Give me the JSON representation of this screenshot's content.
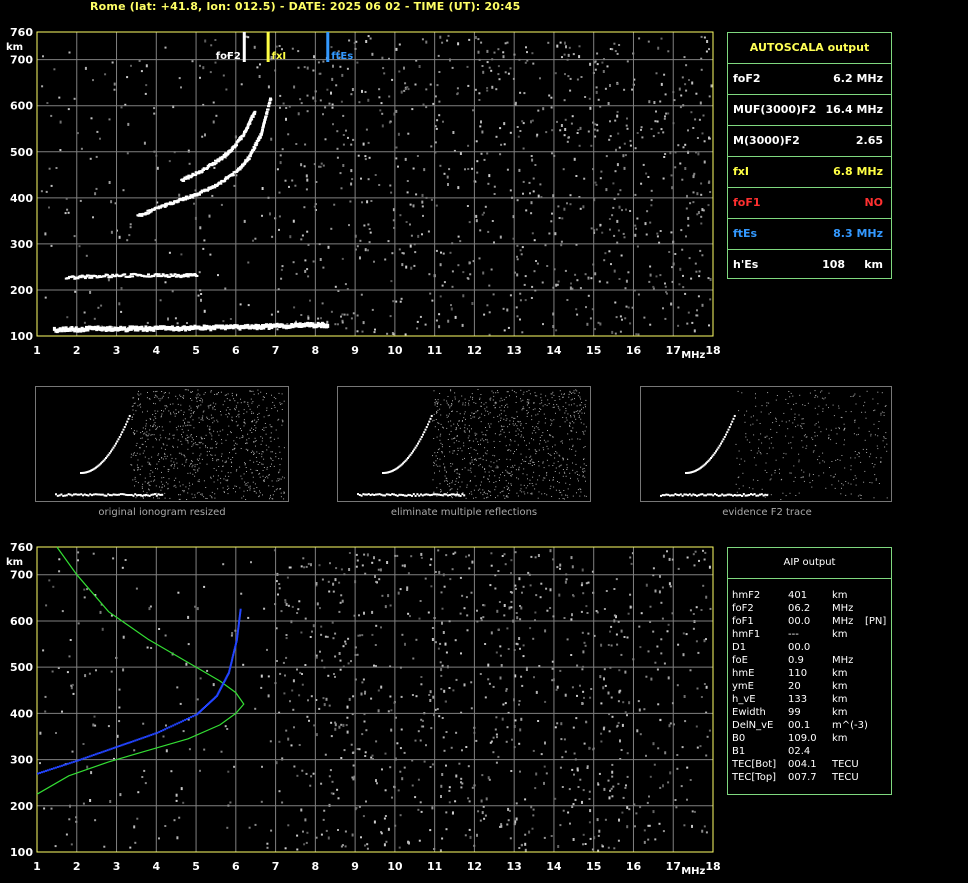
{
  "header": "Rome (lat: +41.8, lon: 012.5) - DATE: 2025 06 02 - TIME (UT): 20:45",
  "colors": {
    "axis": "#ffff66",
    "grid": "#808080",
    "panel_border": "#7fd87f",
    "fof2": "#ffffff",
    "fxi": "#ffff44",
    "ftes": "#3399ff",
    "fof1": "#ff3030",
    "profile": "#33dd33",
    "trace_fit": "#2244ff"
  },
  "chart_data": [
    {
      "id": "ionogram-top",
      "type": "scatter",
      "xlim": [
        1,
        18
      ],
      "ylim": [
        100,
        760
      ],
      "x_ticks": [
        1,
        2,
        3,
        4,
        5,
        6,
        7,
        8,
        9,
        10,
        11,
        12,
        13,
        14,
        15,
        16,
        17,
        18
      ],
      "y_ticks": [
        100,
        200,
        300,
        400,
        500,
        600,
        700,
        760
      ],
      "x_unit": "MHz",
      "y_unit": "km",
      "grid": true,
      "markers": [
        {
          "label": "foF2",
          "x": 6.2,
          "color": "#ffffff"
        },
        {
          "label": "fxI",
          "x": 6.8,
          "color": "#ffff44"
        },
        {
          "label": "ftEs",
          "x": 8.3,
          "color": "#3399ff"
        }
      ],
      "traces": [
        {
          "name_hidden": "Es",
          "x": [
            1.4,
            2.5,
            3.5,
            4.5,
            5.5,
            6.5,
            7.5,
            8.3
          ],
          "y": [
            118,
            120,
            120,
            121,
            122,
            124,
            127,
            128
          ]
        },
        {
          "name_hidden": "Es-2",
          "x": [
            1.7,
            2.5,
            3.5,
            4.5,
            5.0
          ],
          "y": [
            228,
            232,
            234,
            233,
            234
          ]
        },
        {
          "name_hidden": "F2-o",
          "x": [
            3.5,
            4.0,
            4.5,
            5.0,
            5.5,
            6.0,
            6.3,
            6.6,
            6.85
          ],
          "y": [
            362,
            380,
            395,
            410,
            430,
            460,
            490,
            540,
            620
          ]
        },
        {
          "name_hidden": "F2-x",
          "x": [
            4.6,
            5.1,
            5.6,
            5.9,
            6.2,
            6.45
          ],
          "y": [
            440,
            460,
            488,
            510,
            545,
            590
          ]
        }
      ]
    },
    {
      "id": "ionogram-bottom",
      "type": "scatter",
      "xlim": [
        1,
        18
      ],
      "ylim": [
        100,
        760
      ],
      "x_ticks": [
        1,
        2,
        3,
        4,
        5,
        6,
        7,
        8,
        9,
        10,
        11,
        12,
        13,
        14,
        15,
        16,
        17,
        18
      ],
      "y_ticks": [
        100,
        200,
        300,
        400,
        500,
        600,
        700,
        760
      ],
      "x_unit": "MHz",
      "y_unit": "km",
      "grid": true,
      "profile": {
        "x": [
          1.0,
          1.8,
          2.8,
          3.8,
          4.8,
          5.6,
          6.0,
          6.2,
          6.0,
          5.6,
          4.8,
          3.8,
          2.8,
          2.0,
          1.5
        ],
        "y": [
          225,
          265,
          295,
          320,
          345,
          375,
          400,
          420,
          445,
          470,
          510,
          560,
          620,
          700,
          760
        ]
      },
      "fit": {
        "x": [
          1.0,
          2.0,
          3.0,
          4.0,
          5.0,
          5.5,
          5.8,
          6.0,
          6.1
        ],
        "y": [
          272,
          300,
          330,
          360,
          400,
          440,
          490,
          560,
          630
        ]
      }
    }
  ],
  "thumbs": [
    {
      "caption": "original ionogram resized"
    },
    {
      "caption": "eliminate multiple reflections"
    },
    {
      "caption": "evidence F2 trace"
    }
  ],
  "autoscala": {
    "title": "AUTOSCALA output",
    "rows": [
      {
        "label": "foF2",
        "value": "6.2 MHz",
        "color": "#ffffff"
      },
      {
        "label": "MUF(3000)F2",
        "value": "16.4 MHz",
        "color": "#ffffff"
      },
      {
        "label": "M(3000)F2",
        "value": "2.65",
        "color": "#ffffff"
      },
      {
        "label": "fxI",
        "value": "6.8 MHz",
        "color": "#ffff44"
      },
      {
        "label": "foF1",
        "value": "NO",
        "color": "#ff3030"
      },
      {
        "label": "ftEs",
        "value": "8.3 MHz",
        "color": "#3399ff"
      },
      {
        "label": "h'Es",
        "value": "108     km",
        "color": "#ffffff"
      }
    ]
  },
  "aip": {
    "title": "AIP output",
    "rows": [
      {
        "name": "hmF2",
        "value": "401",
        "unit": "km",
        "extra": ""
      },
      {
        "name": "foF2",
        "value": "06.2",
        "unit": "MHz",
        "extra": ""
      },
      {
        "name": "foF1",
        "value": "00.0",
        "unit": "MHz",
        "extra": "[PN]"
      },
      {
        "name": "hmF1",
        "value": "---",
        "unit": "km",
        "extra": ""
      },
      {
        "name": "D1",
        "value": "00.0",
        "unit": "",
        "extra": ""
      },
      {
        "name": "foE",
        "value": "0.9",
        "unit": "MHz",
        "extra": ""
      },
      {
        "name": "hmE",
        "value": "110",
        "unit": "km",
        "extra": ""
      },
      {
        "name": "ymE",
        "value": "20",
        "unit": "km",
        "extra": ""
      },
      {
        "name": "h_vE",
        "value": "133",
        "unit": "km",
        "extra": ""
      },
      {
        "name": "Ewidth",
        "value": "99",
        "unit": "km",
        "extra": ""
      },
      {
        "name": "DelN_vE",
        "value": "00.1",
        "unit": "m^(-3)",
        "extra": ""
      },
      {
        "name": "B0",
        "value": "109.0",
        "unit": "km",
        "extra": ""
      },
      {
        "name": "B1",
        "value": "02.4",
        "unit": "",
        "extra": ""
      },
      {
        "name": "TEC[Bot]",
        "value": "004.1",
        "unit": "TECU",
        "extra": ""
      },
      {
        "name": "TEC[Top]",
        "value": "007.7",
        "unit": "TECU",
        "extra": ""
      }
    ]
  }
}
